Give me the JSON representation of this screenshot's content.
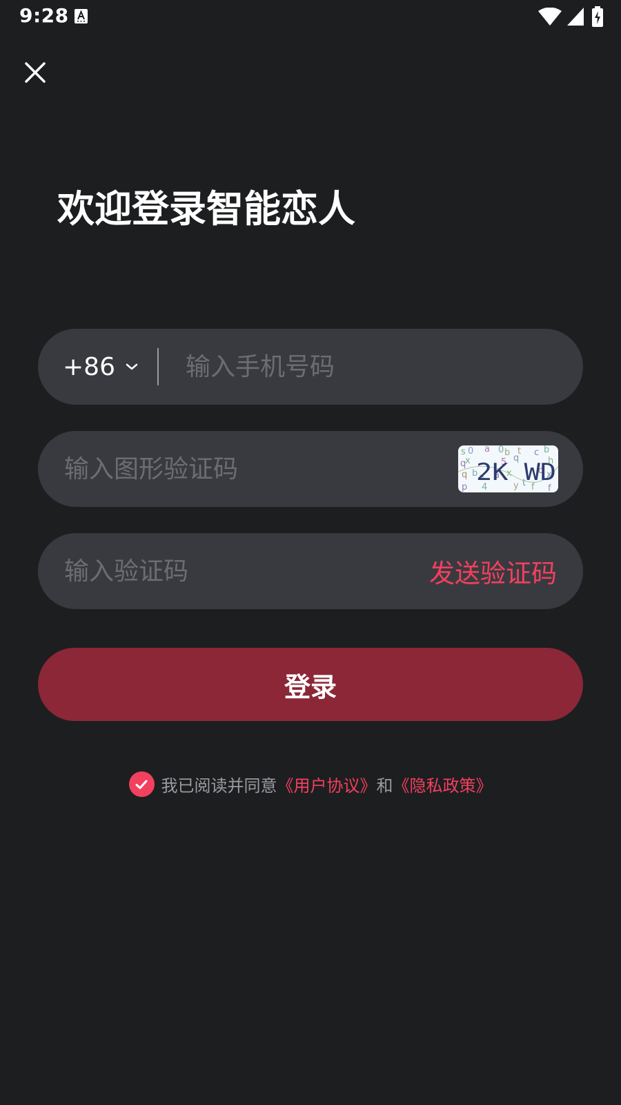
{
  "status_bar": {
    "time": "9:28"
  },
  "title": "欢迎登录智能恋人",
  "phone_field": {
    "country_code": "+86",
    "placeholder": "输入手机号码"
  },
  "captcha_field": {
    "placeholder": "输入图形验证码",
    "captcha_text": "2K WD"
  },
  "code_field": {
    "placeholder": "输入验证码",
    "send_code_label": "发送验证码"
  },
  "login_button": {
    "label": "登录"
  },
  "agreement": {
    "checked": true,
    "prefix": "我已阅读并同意",
    "user_agreement": "《用户协议》",
    "conjunction": "和",
    "privacy_policy": "《隐私政策》"
  },
  "colors": {
    "background": "#1d1e20",
    "field_background": "#393a3f",
    "accent": "#f2405f",
    "login_button": "#8c2738"
  }
}
